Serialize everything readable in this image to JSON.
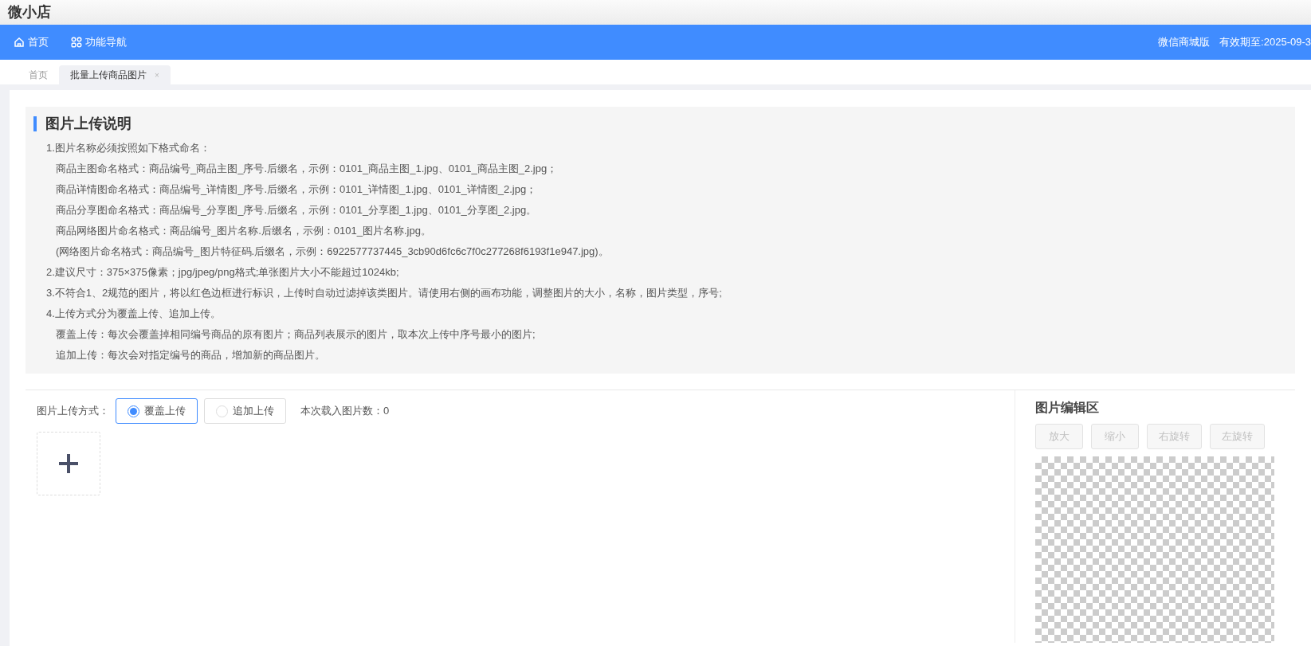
{
  "app_title": "微小店",
  "nav": {
    "items": [
      {
        "label": "首页"
      },
      {
        "label": "功能导航"
      }
    ],
    "edition": "微信商城版",
    "expiry": "有效期至:2025-09-3"
  },
  "tabs": [
    {
      "label": "首页",
      "selected": false
    },
    {
      "label": "批量上传商品图片",
      "selected": true,
      "close": "×"
    }
  ],
  "instructions": {
    "title": "图片上传说明",
    "lines": [
      {
        "text": "1.图片名称必须按照如下格式命名：",
        "children": [
          {
            "text": "商品主图命名格式：商品编号_商品主图_序号.后缀名，示例：0101_商品主图_1.jpg、0101_商品主图_2.jpg；"
          },
          {
            "text": "商品详情图命名格式：商品编号_详情图_序号.后缀名，示例：0101_详情图_1.jpg、0101_详情图_2.jpg；"
          },
          {
            "text": "商品分享图命名格式：商品编号_分享图_序号.后缀名，示例：0101_分享图_1.jpg、0101_分享图_2.jpg。"
          },
          {
            "text": "商品网络图片命名格式：商品编号_图片名称.后缀名，示例：0101_图片名称.jpg。"
          },
          {
            "text": "(网络图片命名格式：商品编号_图片特征码.后缀名，示例：6922577737445_3cb90d6fc6c7f0c277268f6193f1e947.jpg)。"
          }
        ]
      },
      {
        "text": "2.建议尺寸：375×375像素；jpg/jpeg/png格式;单张图片大小不能超过1024kb;"
      },
      {
        "text": "3.不符合1、2规范的图片，将以红色边框进行标识，上传时自动过滤掉该类图片。请使用右侧的画布功能，调整图片的大小，名称，图片类型，序号;"
      },
      {
        "text": "4.上传方式分为覆盖上传、追加上传。",
        "children": [
          {
            "text": "覆盖上传：每次会覆盖掉相同编号商品的原有图片；商品列表展示的图片，取本次上传中序号最小的图片;"
          },
          {
            "text": "追加上传：每次会对指定编号的商品，增加新的商品图片。"
          }
        ]
      }
    ]
  },
  "upload": {
    "mode_label": "图片上传方式：",
    "modes": [
      {
        "label": "覆盖上传",
        "selected": true
      },
      {
        "label": "追加上传",
        "selected": false
      }
    ],
    "count": "本次载入图片数：0"
  },
  "editor": {
    "title": "图片编辑区",
    "buttons": [
      {
        "label": "放大",
        "disabled": true
      },
      {
        "label": "缩小",
        "disabled": true
      },
      {
        "label": "右旋转",
        "disabled": true
      },
      {
        "label": "左旋转",
        "disabled": true
      }
    ]
  }
}
